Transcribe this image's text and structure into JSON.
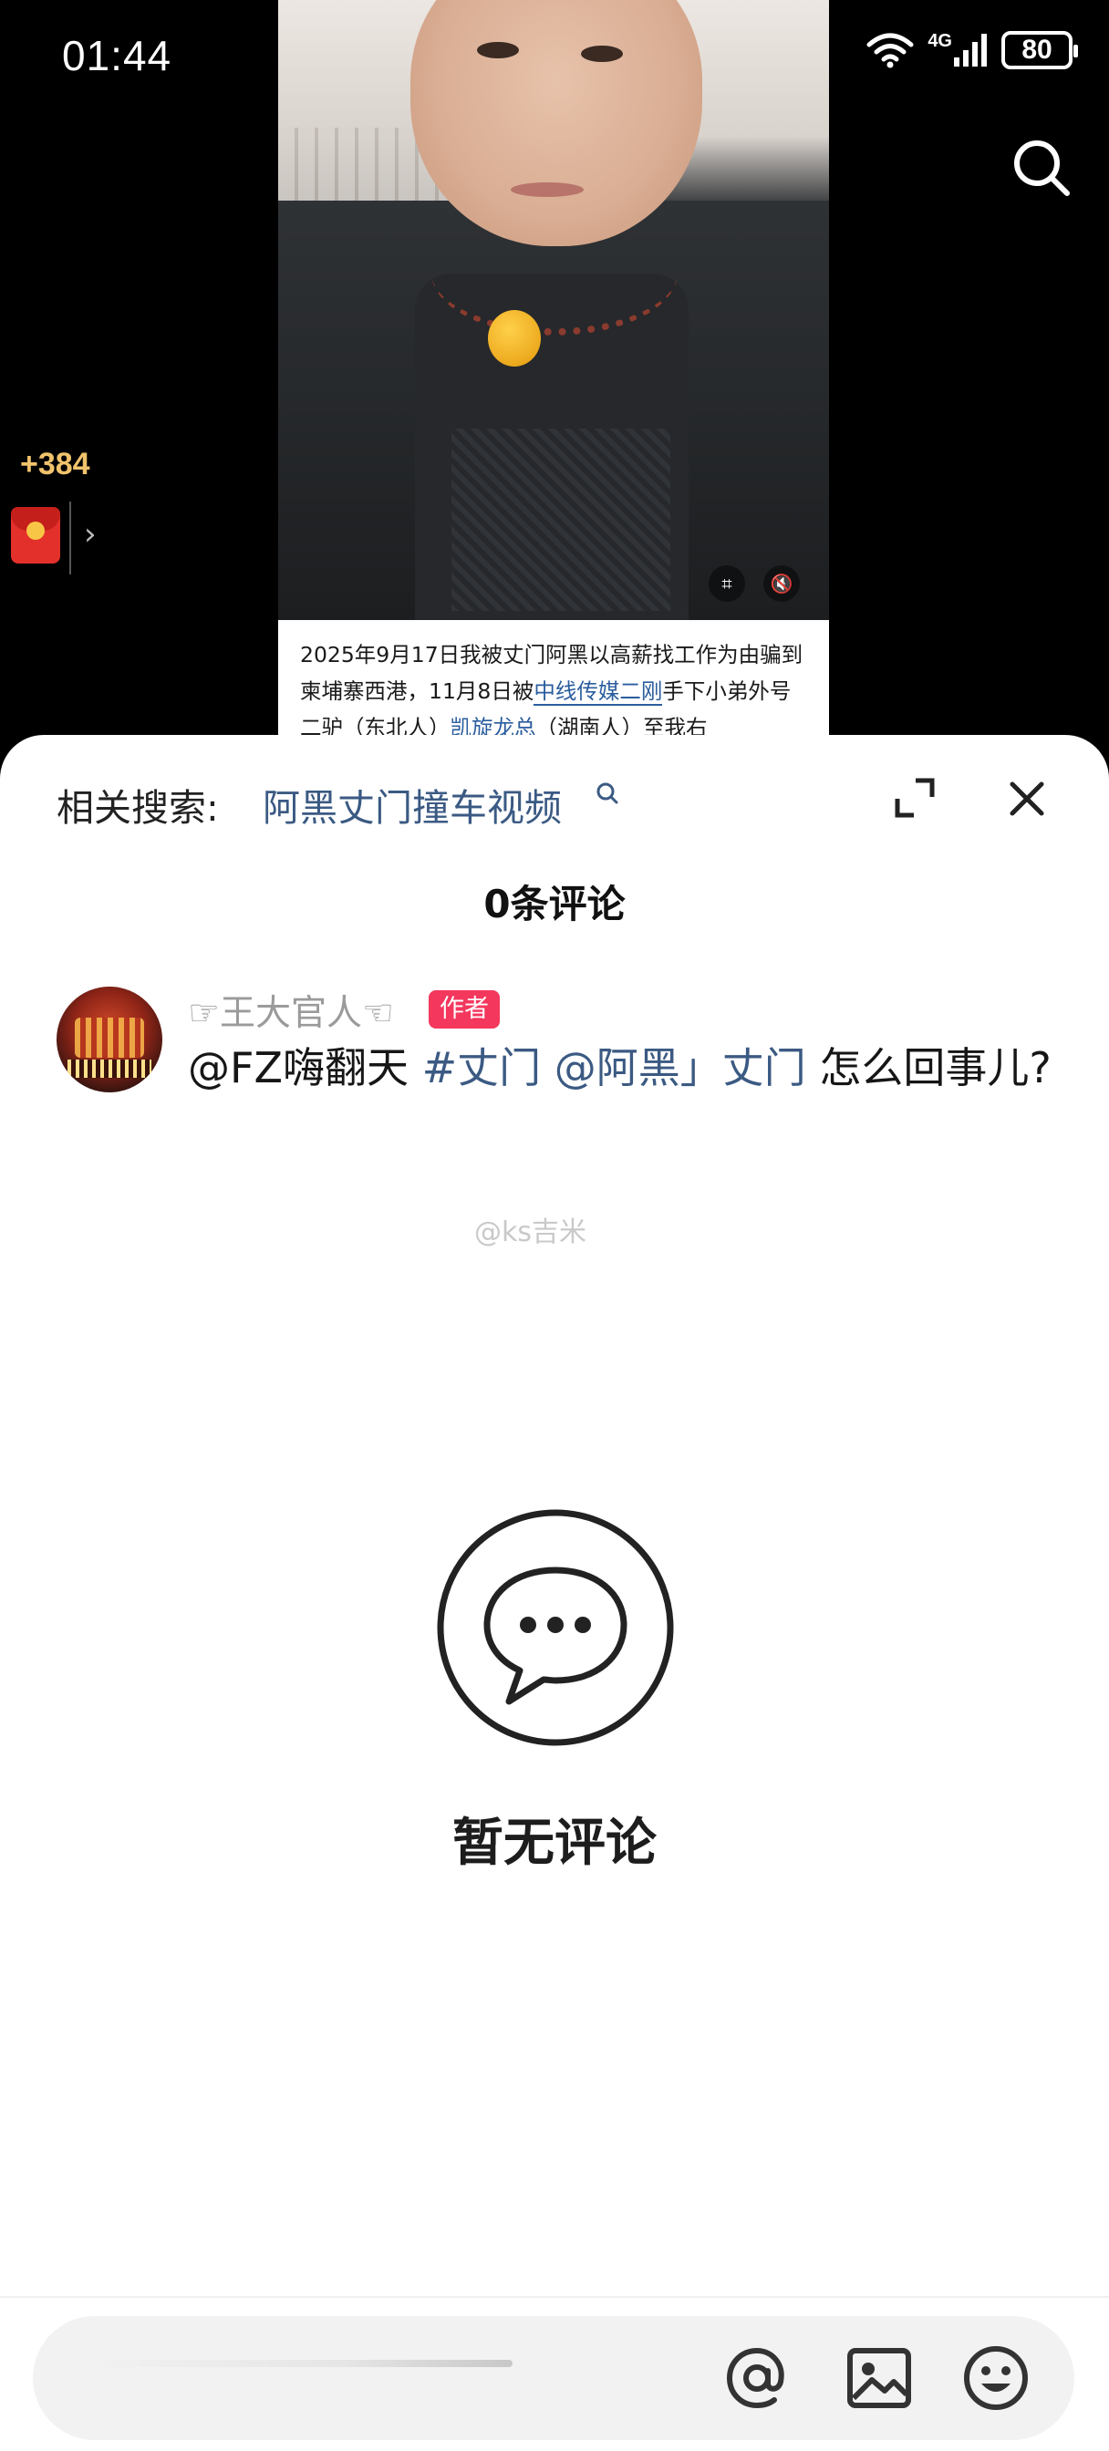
{
  "status_bar": {
    "time": "01:44",
    "network": "4G",
    "battery": "80"
  },
  "video": {
    "reward_count": "+384",
    "caption_parts": [
      "2025年9月17日我被丈门阿黑以高薪找工作为由骗到柬埔寨西港，11月8日被",
      "中线传媒二刚",
      "手下小弟外号二驴（东北人）",
      "凯旋龙总",
      "（湖南人）至我右"
    ]
  },
  "related": {
    "label": "相关搜索:",
    "query": "阿黑丈门撞车视频"
  },
  "comments_title": "0条评论",
  "comment": {
    "username": "☞王大官人☜",
    "badge": "作者",
    "mention": "@FZ嗨翻天 ",
    "tag1": "#丈门",
    "mention2": " @阿黑」丈门",
    "text_tail": " 怎么回事儿?"
  },
  "watermark": "@ks吉米",
  "empty": {
    "text": "暂无评论"
  },
  "icons": [
    "wifi-icon",
    "signal-icon",
    "battery-icon",
    "search-icon",
    "red-envelope-icon",
    "chevron-right-icon",
    "screenshot-icon",
    "mute-icon",
    "expand-icon",
    "close-icon",
    "comment-bubble-icon",
    "at-icon",
    "image-icon",
    "emoji-icon"
  ],
  "colors": {
    "link": "#3b5a83",
    "badge": "#f4375d",
    "reward": "#f1c36c"
  }
}
